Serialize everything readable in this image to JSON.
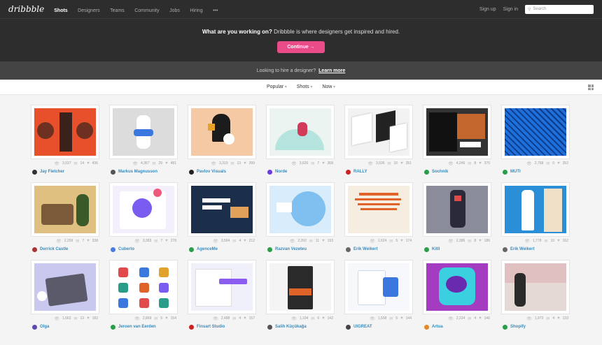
{
  "header": {
    "logo": "dribbble",
    "nav": [
      "Shots",
      "Designers",
      "Teams",
      "Community",
      "Jobs",
      "Hiring",
      "•••"
    ],
    "signup": "Sign up",
    "signin": "Sign in",
    "search_placeholder": "Search"
  },
  "hero": {
    "bold": "What are you working on?",
    "rest": " Dribbble is where designers get inspired and hired.",
    "button": "Continue →"
  },
  "hire": {
    "text": "Looking to hire a designer?",
    "link": "Learn more"
  },
  "filters": [
    "Popular",
    "Shots",
    "Now"
  ],
  "shots": [
    {
      "author": "Jay Fletcher",
      "views": "3,537",
      "comments": "14",
      "likes": "436",
      "bg": "#e8502b",
      "av": "#333"
    },
    {
      "author": "Markus Magnusson",
      "views": "4,367",
      "comments": "29",
      "likes": "481",
      "bg": "#dcdcdc",
      "av": "#555"
    },
    {
      "author": "Pavlov Visuals",
      "views": "3,319",
      "comments": "13",
      "likes": "399",
      "bg": "#f4c9a4",
      "av": "#222"
    },
    {
      "author": "Norde",
      "views": "3,626",
      "comments": "7",
      "likes": "368",
      "bg": "#ecf4f2",
      "av": "#6a3be0"
    },
    {
      "author": "RALLY",
      "views": "3,536",
      "comments": "10",
      "likes": "351",
      "bg": "#f2f2f2",
      "av": "#c22"
    },
    {
      "author": "Sochnik",
      "views": "4,246",
      "comments": "8",
      "likes": "376",
      "bg": "#333333",
      "av": "#2a9d4a"
    },
    {
      "author": "MUTI",
      "views": "2,768",
      "comments": "0",
      "likes": "352",
      "bg": "#1e6fd9",
      "av": "#2a9d4a"
    },
    {
      "author": "Derrick Castle",
      "views": "2,269",
      "comments": "7",
      "likes": "338",
      "bg": "#e0c080",
      "av": "#a33"
    },
    {
      "author": "Cuberto",
      "views": "3,383",
      "comments": "7",
      "likes": "278",
      "bg": "#f3f0fb",
      "av": "#4a7be0"
    },
    {
      "author": "AgenceMe",
      "views": "3,564",
      "comments": "4",
      "likes": "212",
      "bg": "#1b2e4a",
      "av": "#2a9d4a"
    },
    {
      "author": "Razvan Vezeteu",
      "views": "2,260",
      "comments": "11",
      "likes": "193",
      "bg": "#d9ecfb",
      "av": "#2a9d4a"
    },
    {
      "author": "Erik Weikert",
      "views": "1,624",
      "comments": "5",
      "likes": "174",
      "bg": "#f5ede0",
      "av": "#666"
    },
    {
      "author": "Kitll",
      "views": "2,386",
      "comments": "8",
      "likes": "186",
      "bg": "#8a8c9a",
      "av": "#2a9d4a"
    },
    {
      "author": "Erik Weikert",
      "views": "1,778",
      "comments": "10",
      "likes": "162",
      "bg": "#2b8fd8",
      "av": "#666"
    },
    {
      "author": "Olga",
      "views": "1,662",
      "comments": "13",
      "likes": "182",
      "bg": "#c9c8ee",
      "av": "#5a4ab0"
    },
    {
      "author": "Jeroen van Eerden",
      "views": "2,869",
      "comments": "5",
      "likes": "154",
      "bg": "#ffffff",
      "av": "#2a9d4a"
    },
    {
      "author": "Finsart Studio",
      "views": "2,488",
      "comments": "4",
      "likes": "157",
      "bg": "#f0f0fa",
      "av": "#c22"
    },
    {
      "author": "Salih Küçükağa",
      "views": "1,104",
      "comments": "6",
      "likes": "142",
      "bg": "#f4f4f4",
      "av": "#555"
    },
    {
      "author": "UIGREAT",
      "views": "1,558",
      "comments": "5",
      "likes": "144",
      "bg": "#f6f8fc",
      "av": "#444"
    },
    {
      "author": "Artua",
      "views": "2,224",
      "comments": "4",
      "likes": "146",
      "bg": "#a33cc0",
      "av": "#e08a2a"
    },
    {
      "author": "Shopify",
      "views": "1,973",
      "comments": "4",
      "likes": "133",
      "bg": "#e5d9d5",
      "av": "#2a9d4a"
    }
  ]
}
